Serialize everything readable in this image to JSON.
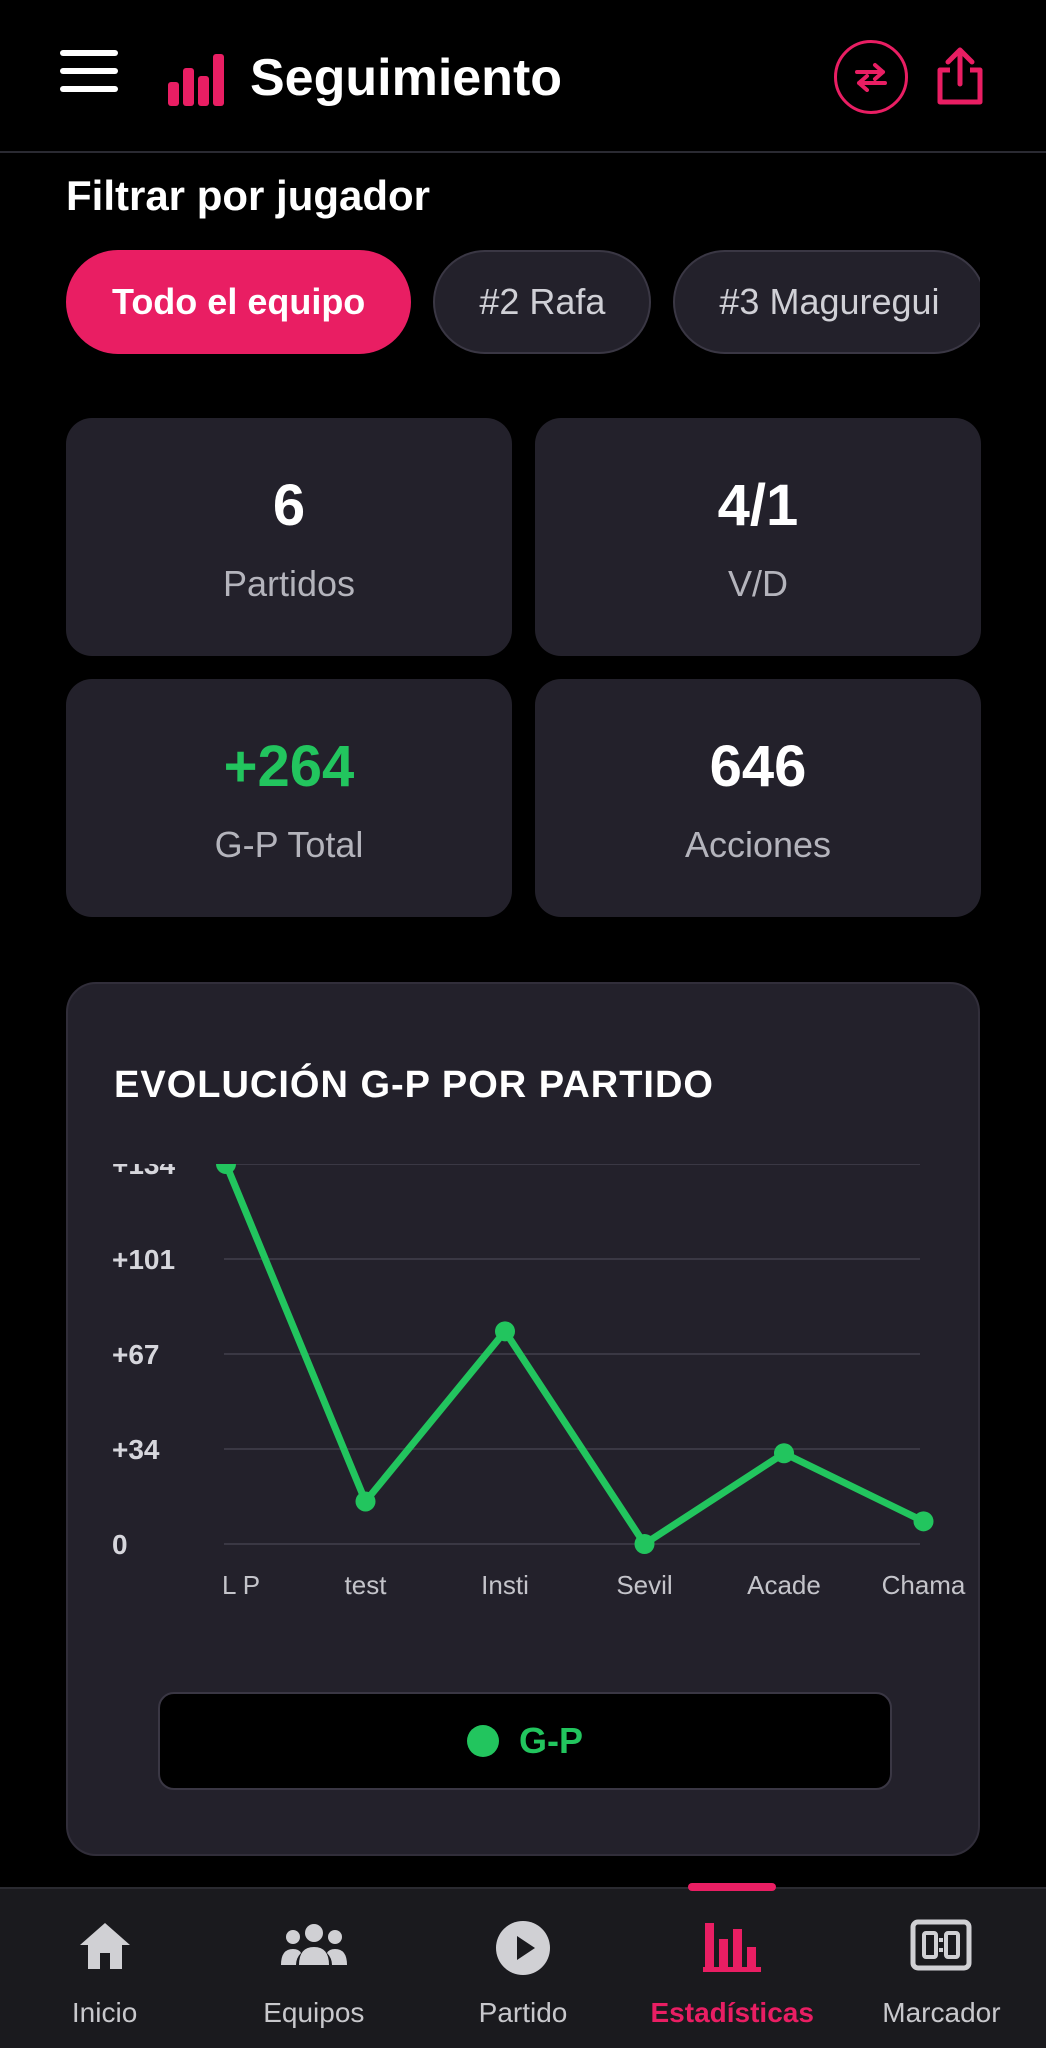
{
  "header": {
    "title": "Seguimiento",
    "icons": {
      "menu": "hamburger-icon",
      "logo": "bar-chart-logo",
      "swap": "swap-arrows-icon",
      "share": "share-icon"
    }
  },
  "filter": {
    "title": "Filtrar por jugador",
    "chips": [
      "Todo el equipo",
      "#2 Rafa",
      "#3 Maguregui"
    ],
    "selected": "Todo el equipo"
  },
  "stats": [
    {
      "value": "6",
      "label": "Partidos"
    },
    {
      "value": "4/1",
      "label": "V/D"
    },
    {
      "value": "+264",
      "label": "G-P Total"
    },
    {
      "value": "646",
      "label": "Acciones"
    }
  ],
  "chart_data": {
    "type": "line",
    "title": "EVOLUCIÓN G-P POR PARTIDO",
    "categories": [
      "L P",
      "test",
      "Insti",
      "Sevil",
      "Acade",
      "Chama"
    ],
    "series": [
      {
        "name": "G-P",
        "values": [
          134,
          15,
          75,
          0,
          32,
          8
        ]
      }
    ],
    "y_ticks": [
      "+134",
      "+101",
      "+67",
      "+34",
      "0"
    ],
    "ylim": [
      0,
      134
    ],
    "grid": true,
    "legend": "bottom",
    "colors": {
      "line": "#22c55e",
      "grid": "#3a3844"
    }
  },
  "bottom_nav": {
    "items": [
      {
        "label": "Inicio",
        "icon": "home-icon"
      },
      {
        "label": "Equipos",
        "icon": "group-icon"
      },
      {
        "label": "Partido",
        "icon": "play-circle-icon"
      },
      {
        "label": "Estadísticas",
        "icon": "bar-chart-icon"
      },
      {
        "label": "Marcador",
        "icon": "scoreboard-icon"
      }
    ],
    "active": "Estadísticas"
  },
  "colors": {
    "accent": "#e91e63",
    "positive": "#22c55e",
    "card": "#23212b",
    "background": "#000000"
  }
}
